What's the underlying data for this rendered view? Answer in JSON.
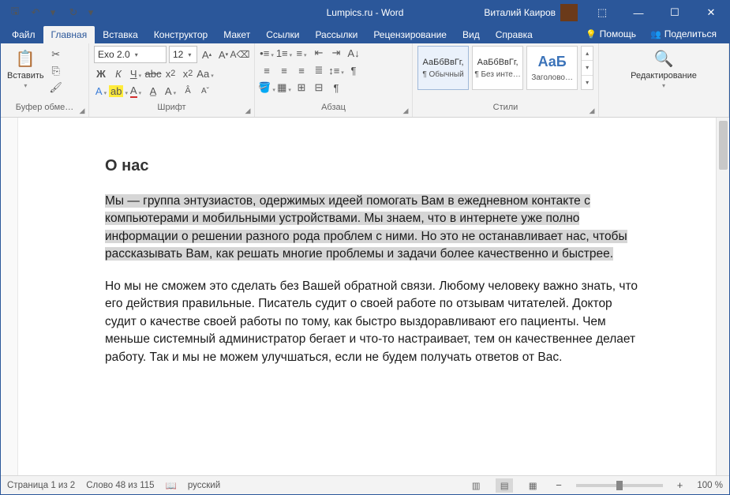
{
  "titlebar": {
    "title": "Lumpics.ru - Word",
    "user": "Виталий Каиров"
  },
  "tabs": {
    "file": "Файл",
    "home": "Главная",
    "insert": "Вставка",
    "design": "Конструктор",
    "layout": "Макет",
    "references": "Ссылки",
    "mailings": "Рассылки",
    "review": "Рецензирование",
    "view": "Вид",
    "help": "Справка",
    "tell_me": "Помощь",
    "share": "Поделиться"
  },
  "ribbon": {
    "clipboard": {
      "paste": "Вставить",
      "label": "Буфер обме…"
    },
    "font": {
      "name": "Exo 2.0",
      "size": "12",
      "label": "Шрифт"
    },
    "paragraph": {
      "label": "Абзац"
    },
    "styles": {
      "label": "Стили",
      "preview1": "АаБбВвГг,",
      "name1": "¶ Обычный",
      "preview2": "АаБбВвГг,",
      "name2": "¶ Без инте…",
      "preview3": "АаБ",
      "name3": "Заголово…"
    },
    "editing": {
      "label": "Редактирование"
    }
  },
  "document": {
    "heading": "О нас",
    "p1": "Мы — группа энтузиастов, одержимых идеей помогать Вам в ежедневном контакте с компьютерами и мобильными устройствами. Мы знаем, что в интернете уже полно информации о решении разного рода проблем с ними. Но это не останавливает нас, чтобы рассказывать Вам, как решать многие проблемы и задачи более качественно и быстрее.",
    "p2": "Но мы не сможем это сделать без Вашей обратной связи. Любому человеку важно знать, что его действия правильные. Писатель судит о своей работе по отзывам читателей. Доктор судит о качестве своей работы по тому, как быстро выздоравливают его пациенты. Чем меньше системный администратор бегает и что-то настраивает, тем он качественнее делает работу. Так и мы не можем улучшаться, если не будем получать ответов от Вас."
  },
  "status": {
    "page": "Страница 1 из 2",
    "words": "Слово 48 из 115",
    "lang": "русский",
    "zoom": "100 %"
  }
}
